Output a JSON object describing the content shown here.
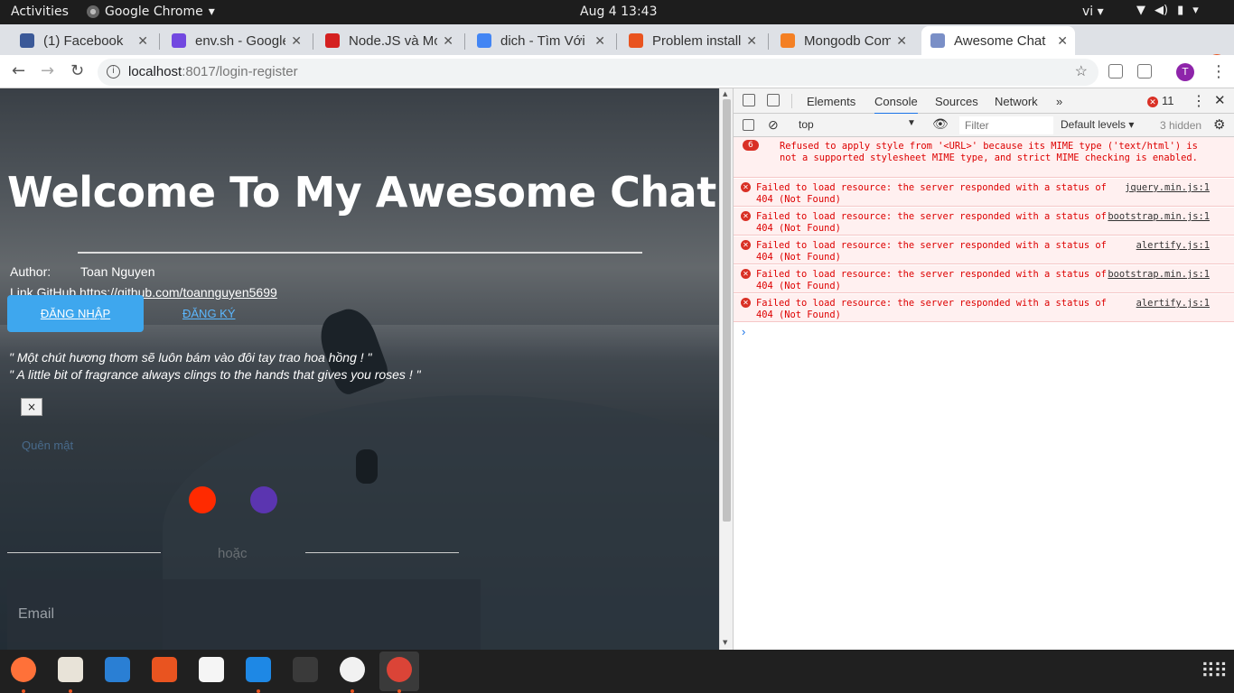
{
  "topbar": {
    "activities": "Activities",
    "app_name": "Google Chrome",
    "clock": "Aug 4  13:43",
    "lang": "vi"
  },
  "tabs": [
    {
      "label": "(1) Facebook",
      "icon": "facebook-icon",
      "color": "#3b5998"
    },
    {
      "label": "env.sh - Google",
      "icon": "google-docs-icon",
      "color": "#7248e0"
    },
    {
      "label": "Node.JS và Mo",
      "icon": "node-icon",
      "color": "#d42020"
    },
    {
      "label": "dich - Tìm Với G",
      "icon": "google-icon",
      "color": "#4285f4"
    },
    {
      "label": "Problem install",
      "icon": "askubuntu-icon",
      "color": "#e95420"
    },
    {
      "label": "Mongodb Com",
      "icon": "stackoverflow-icon",
      "color": "#f48024"
    },
    {
      "label": "Awesome Chat",
      "icon": "awesome-chat-icon",
      "color": "#7a8fc7"
    }
  ],
  "address": {
    "host": "localhost",
    "path": ":8017/login-register"
  },
  "profile_initial": "T",
  "page": {
    "title": "Welcome To My Awesome Chat",
    "author_label": "Author:",
    "author_name": "Toan Nguyen",
    "github_label": "Link GitHub",
    "github_url": "https://github.com/toannguyen5699",
    "login_button": "ĐĂNG NHẬP",
    "register_link": "ĐĂNG KÝ",
    "quote_vi": "\" Một chút hương thơm sẽ luôn bám vào đôi tay trao hoa hồng ! \"",
    "quote_en": "\" A little bit of fragrance always clings to the hands that gives you roses ! \"",
    "close_label": "×",
    "faded_link": "Quên mật",
    "or_label": "hoặc",
    "email_placeholder": "Email"
  },
  "devtools": {
    "tabs": [
      "Elements",
      "Console",
      "Sources",
      "Network"
    ],
    "active_tab": "Console",
    "more": "»",
    "error_count": "11",
    "context": "top",
    "filter_placeholder": "Filter",
    "levels": "Default levels ▾",
    "hidden": "3 hidden",
    "logs": [
      {
        "badge": "6",
        "message": "Refused to apply style from '<URL>' because its MIME type ('text/html') is not a supported stylesheet MIME type, and strict MIME checking is enabled.",
        "source": ""
      },
      {
        "badge": "",
        "message": "Failed to load resource: the server responded with a status of 404 (Not Found)",
        "source": "jquery.min.js:1"
      },
      {
        "badge": "",
        "message": "Failed to load resource: the server responded with a status of 404 (Not Found)",
        "source": "bootstrap.min.js:1"
      },
      {
        "badge": "",
        "message": "Failed to load resource: the server responded with a status of 404 (Not Found)",
        "source": "alertify.js:1"
      },
      {
        "badge": "",
        "message": "Failed to load resource: the server responded with a status of 404 (Not Found)",
        "source": "bootstrap.min.js:1"
      },
      {
        "badge": "",
        "message": "Failed to load resource: the server responded with a status of 404 (Not Found)",
        "source": "alertify.js:1"
      }
    ],
    "prompt": "›"
  },
  "dock": [
    {
      "name": "firefox-icon",
      "color": "#ff7139",
      "running": true
    },
    {
      "name": "files-icon",
      "color": "#e8e3d8",
      "running": true
    },
    {
      "name": "writer-icon",
      "color": "#2a7fd4",
      "running": false
    },
    {
      "name": "software-icon",
      "color": "#e95420",
      "running": false
    },
    {
      "name": "amazon-icon",
      "color": "#f5f5f5",
      "running": false
    },
    {
      "name": "vscode-icon",
      "color": "#1e88e5",
      "running": true
    },
    {
      "name": "terminal-icon",
      "color": "#3a3a3a",
      "running": false
    },
    {
      "name": "mongodb-compass-icon",
      "color": "#f1f1f1",
      "running": true
    },
    {
      "name": "chrome-icon",
      "color": "#db4437",
      "running": true
    }
  ],
  "colors": {
    "login_button": "#3ea7ee",
    "social_red": "#ff2a00",
    "social_purple": "#5b35b0",
    "error_red": "#d93025"
  }
}
